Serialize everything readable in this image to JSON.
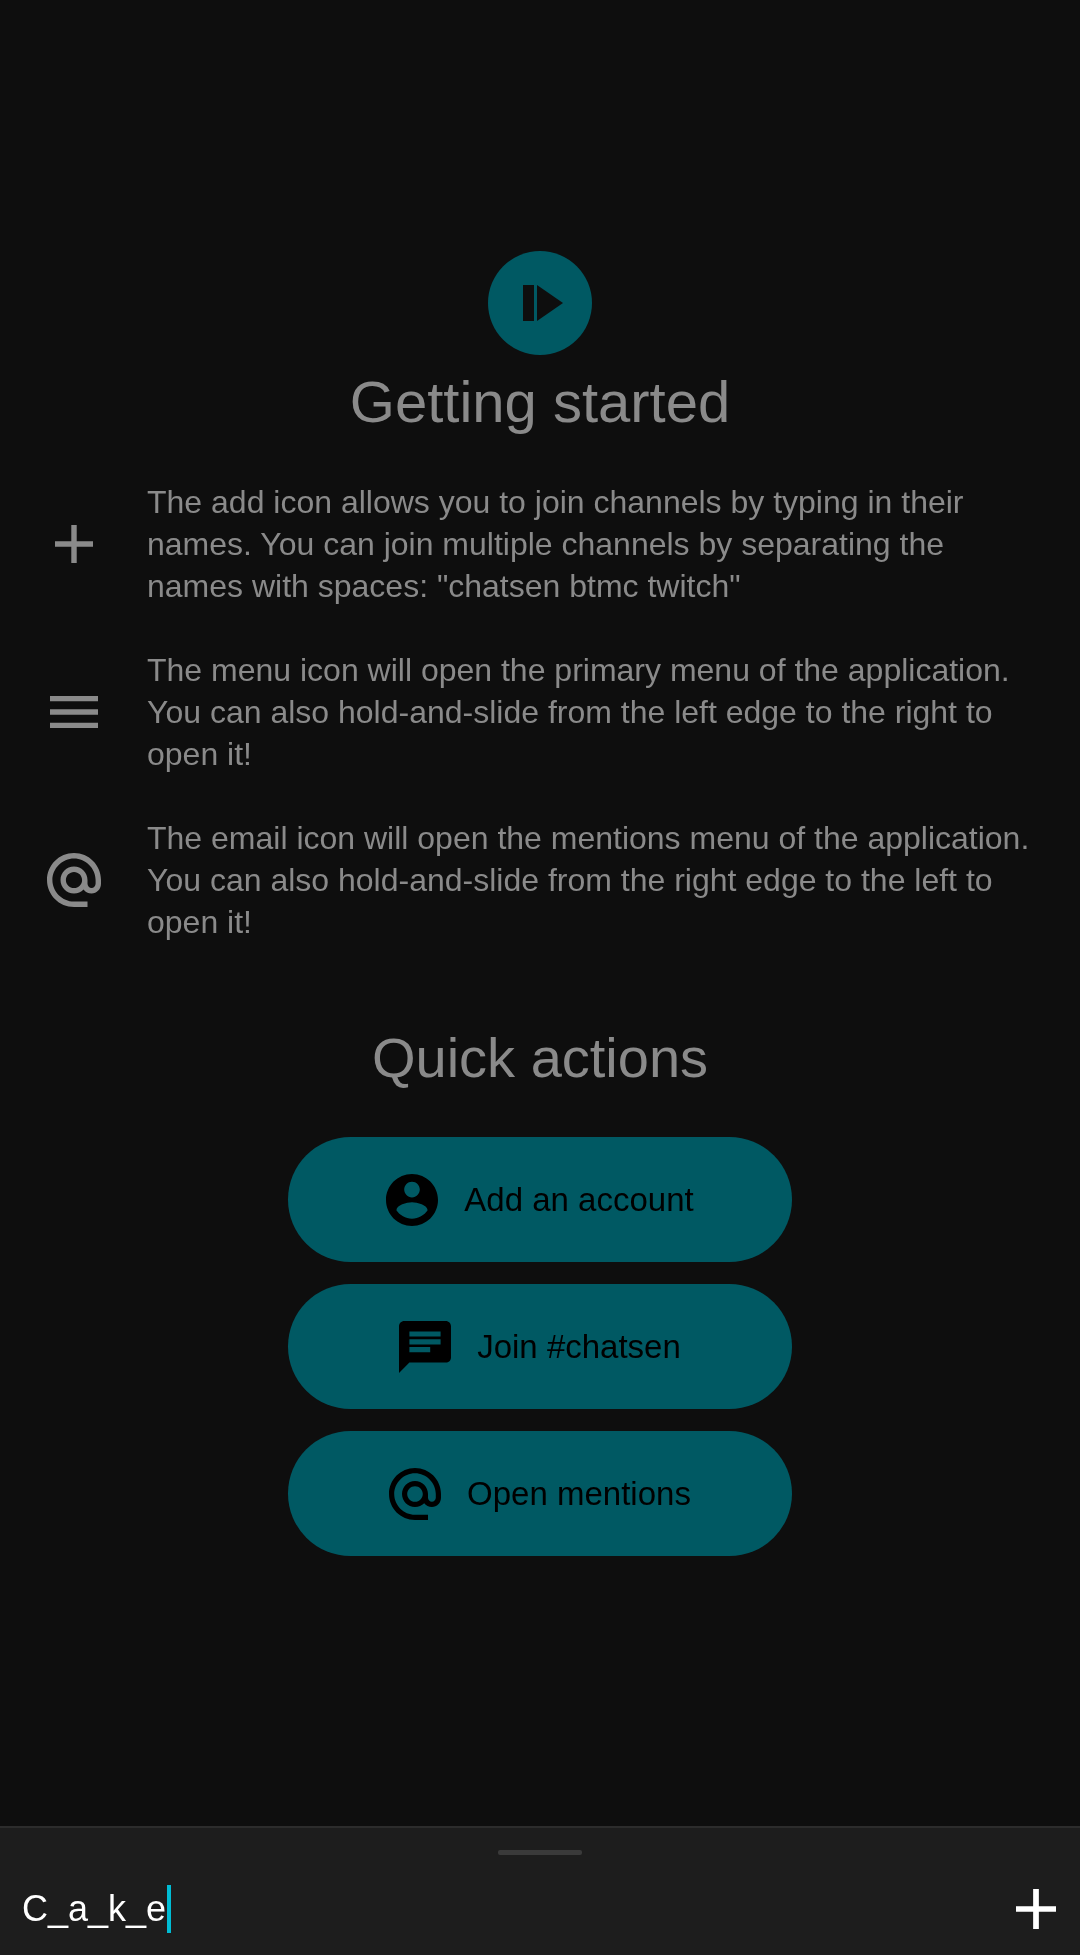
{
  "header": {
    "title": "Getting started"
  },
  "tips": [
    {
      "kind": "add",
      "text": "The add icon allows you to join channels by typing in their names. You can join multiple channels by separating the names with spaces: \"chatsen btmc twitch\""
    },
    {
      "kind": "menu",
      "text": "The menu icon will open the primary menu of the application. You can also hold-and-slide from the left edge to the right to open it!"
    },
    {
      "kind": "mention",
      "text": "The email icon will open the mentions menu of the application. You can also hold-and-slide from the right edge to the left to open it!"
    }
  ],
  "quick_actions": {
    "title": "Quick actions",
    "buttons": [
      {
        "kind": "account",
        "label": "Add an account"
      },
      {
        "kind": "chat",
        "label": "Join #chatsen"
      },
      {
        "kind": "mention",
        "label": "Open mentions"
      }
    ]
  },
  "composer": {
    "value": "C_a_k_e"
  }
}
